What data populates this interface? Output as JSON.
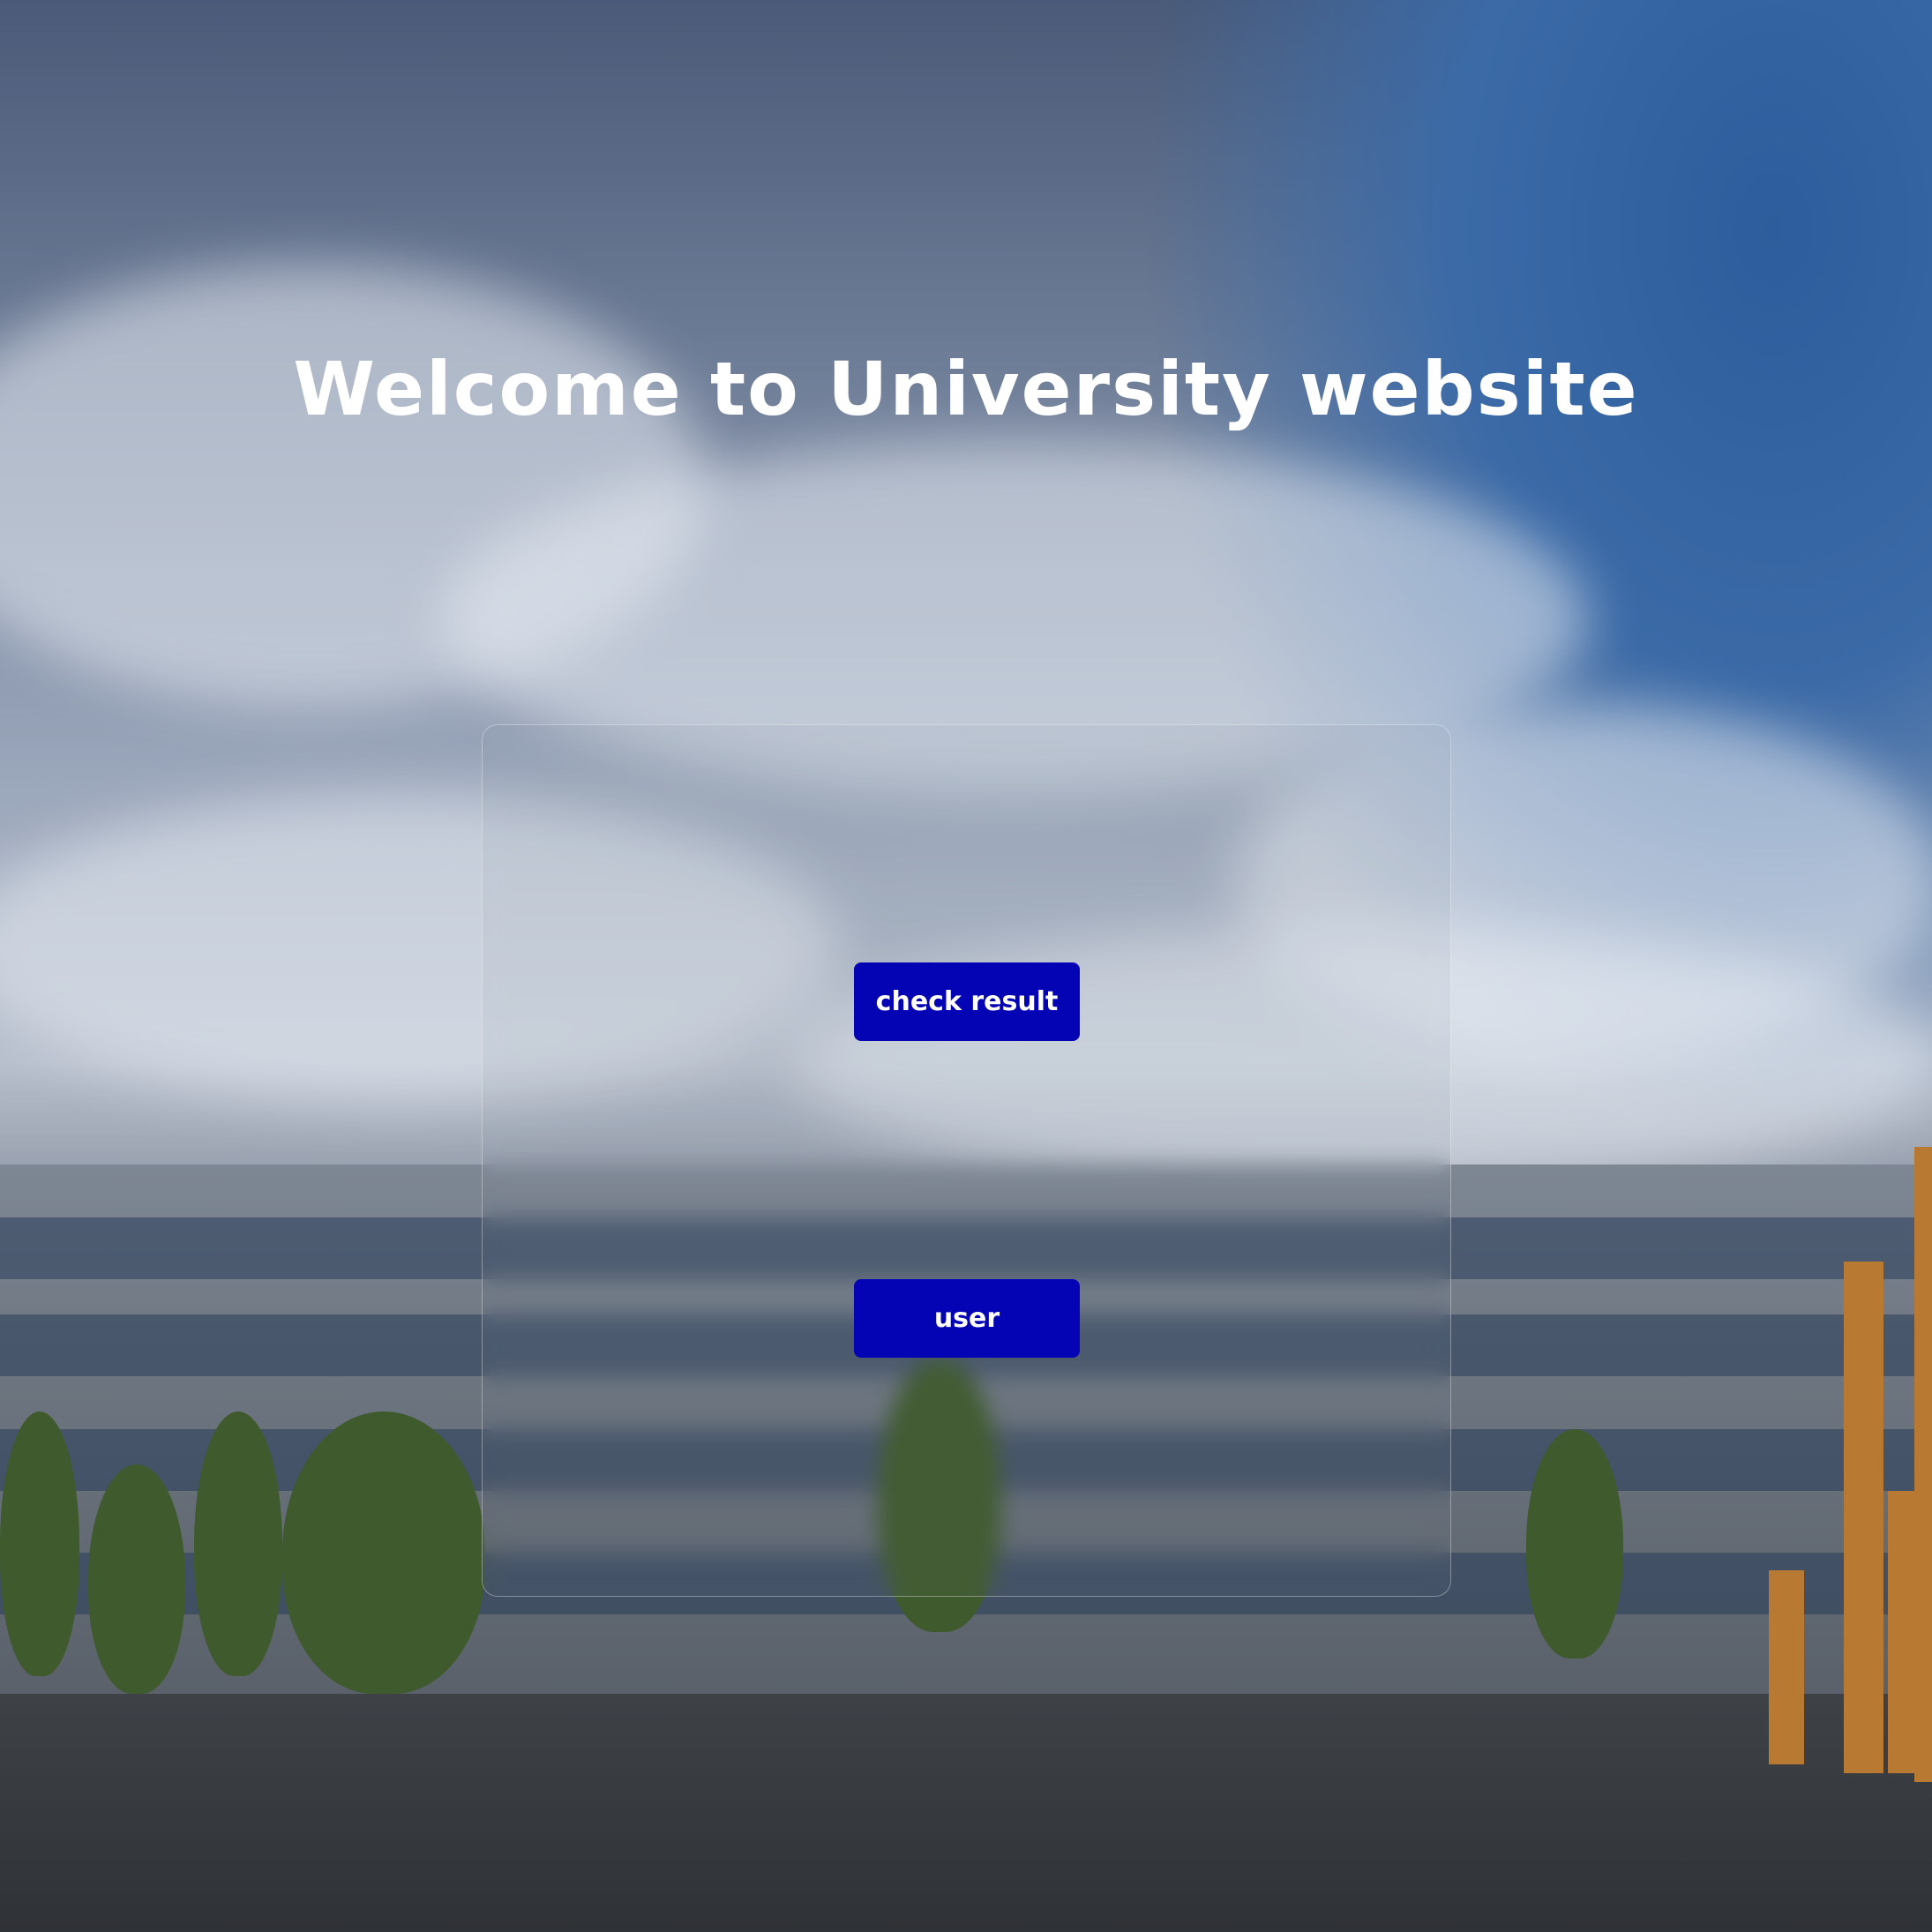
{
  "header": {
    "title": "Welcome to University website"
  },
  "actions": {
    "check_result_label": "check result",
    "user_label": "user"
  },
  "colors": {
    "button_bg": "#0504b4",
    "button_text": "#ffffff",
    "title_text": "#ffffff"
  }
}
